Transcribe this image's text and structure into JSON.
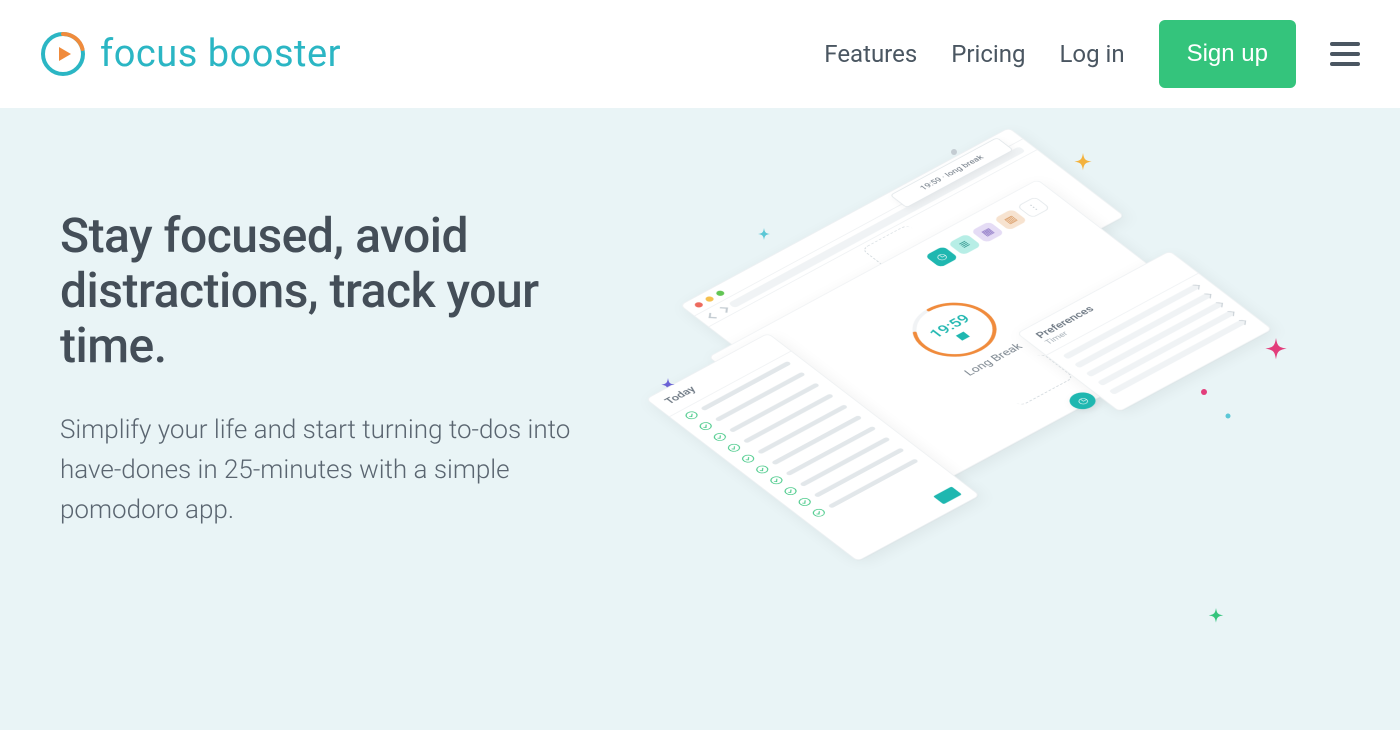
{
  "brand": {
    "name": "focus booster"
  },
  "nav": {
    "features": "Features",
    "pricing": "Pricing",
    "login": "Log in",
    "signup": "Sign up"
  },
  "hero": {
    "headline": "Stay focused, avoid distractions, track your time.",
    "subhead": "Simplify your life and start turning to-dos into have-dones in 25-minutes with a simple pomodoro app."
  },
  "illustration": {
    "mini_timer": "19:59 · long break",
    "today_heading": "Today",
    "timer_value": "19:59",
    "timer_label": "Long Break",
    "prefs_heading": "Preferences",
    "prefs_sub": "Timer"
  },
  "colors": {
    "accent_teal": "#2bb6c4",
    "cta_green": "#34c47c",
    "hero_bg": "#e9f4f6",
    "ink": "#4a5661"
  }
}
